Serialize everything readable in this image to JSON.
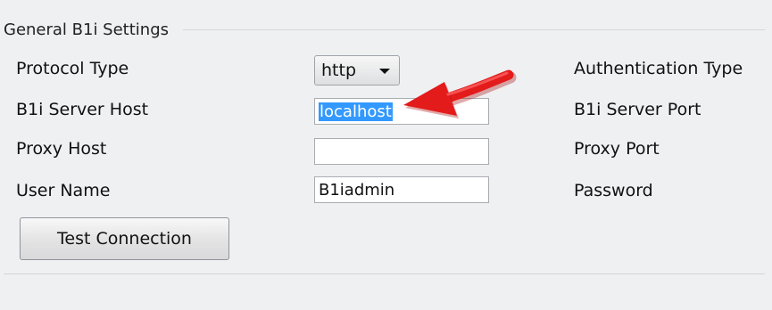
{
  "group": {
    "title": "General B1i Settings"
  },
  "left_labels": {
    "protocol_type": "Protocol Type",
    "server_host": "B1i Server Host",
    "proxy_host": "Proxy Host",
    "user_name": "User Name"
  },
  "right_labels": {
    "authentication_type": "Authentication Type",
    "server_port": "B1i Server Port",
    "proxy_port": "Proxy Port",
    "password": "Password"
  },
  "fields": {
    "protocol_type_value": "http",
    "server_host_value": "localhost",
    "proxy_host_value": "",
    "user_name_value": "B1iadmin"
  },
  "buttons": {
    "test_connection": "Test Connection"
  },
  "annotation": {
    "arrow_color": "#e31b1b"
  },
  "icons": {
    "dropdown": "chevron-down-icon",
    "annotation": "red-arrow-icon"
  }
}
